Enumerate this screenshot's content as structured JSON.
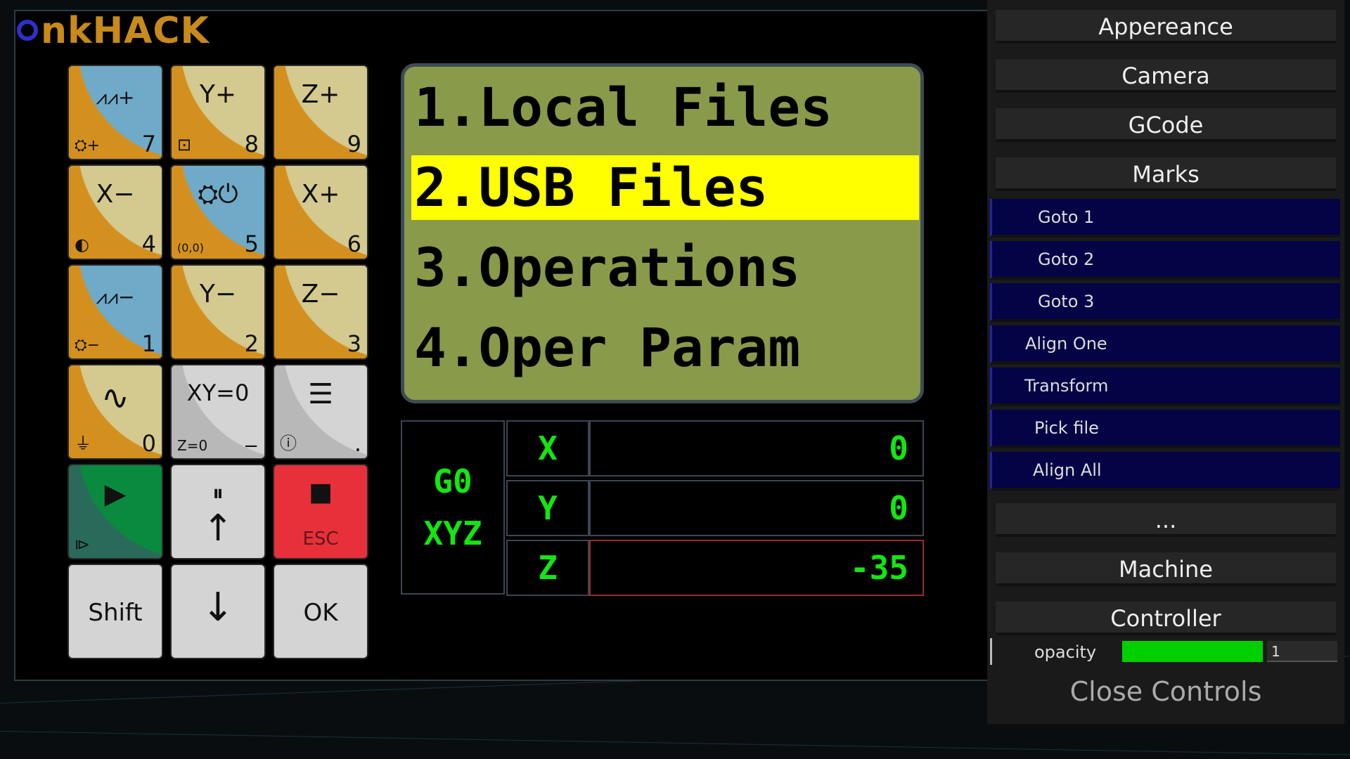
{
  "logo": {
    "mark": "O",
    "text": "nkHACK"
  },
  "keypad": {
    "keys": [
      {
        "top": "W+",
        "num": "7",
        "sub": "spindle+"
      },
      {
        "top": "Y+",
        "num": "8",
        "sub": "frame"
      },
      {
        "top": "Z+",
        "num": "9",
        "sub": ""
      },
      {
        "top": "X−",
        "num": "4",
        "sub": "◐"
      },
      {
        "top": "spindle",
        "num": "5",
        "sub": "(0,0)"
      },
      {
        "top": "X+",
        "num": "6",
        "sub": ""
      },
      {
        "top": "W−",
        "num": "1",
        "sub": "spindle−"
      },
      {
        "top": "Y−",
        "num": "2",
        "sub": ""
      },
      {
        "top": "Z−",
        "num": "3",
        "sub": ""
      },
      {
        "top": "∿",
        "num": "0",
        "sub": "probe"
      },
      {
        "top": "XY=0",
        "num": "−",
        "sub": "Z=0"
      },
      {
        "top": "list",
        "num": ".",
        "sub": "?"
      },
      {
        "top": "▶",
        "num": "",
        "sub": ""
      },
      {
        "top": "⏸",
        "num": "",
        "sub": ""
      },
      {
        "top": "■",
        "num": "",
        "sub": "ESC"
      },
      {
        "top": "Shift"
      },
      {
        "top": "↓"
      },
      {
        "top": "OK"
      }
    ]
  },
  "lcd": {
    "lines": [
      "1.Local Files",
      "2.USB Files",
      "3.Operations",
      "4.Oper Param"
    ],
    "selected_index": 1
  },
  "coords": {
    "mode_line1": "G0",
    "mode_line2": "XYZ",
    "axes": [
      {
        "label": "X",
        "value": "0"
      },
      {
        "label": "Y",
        "value": "0"
      },
      {
        "label": "Z",
        "value": "-35"
      }
    ]
  },
  "controls": {
    "sections": [
      "Appereance",
      "Camera",
      "GCode",
      "Marks"
    ],
    "marks_items": [
      "Goto 1",
      "Goto 2",
      "Goto 3",
      "Align One",
      "Transform",
      "Pick file",
      "Align All"
    ],
    "more": "...",
    "sections2": [
      "Machine",
      "Controller"
    ],
    "opacity_label": "opacity",
    "opacity_value": "1",
    "opacity_fraction": 1,
    "close_label": "Close Controls"
  },
  "colors": {
    "lcd_bg": "#899a4a",
    "lcd_select": "#ffff00",
    "readout_green": "#13e613",
    "logo": "#c88a1a",
    "esc_red": "#e8303a",
    "start_green": "#0a8a3e"
  }
}
